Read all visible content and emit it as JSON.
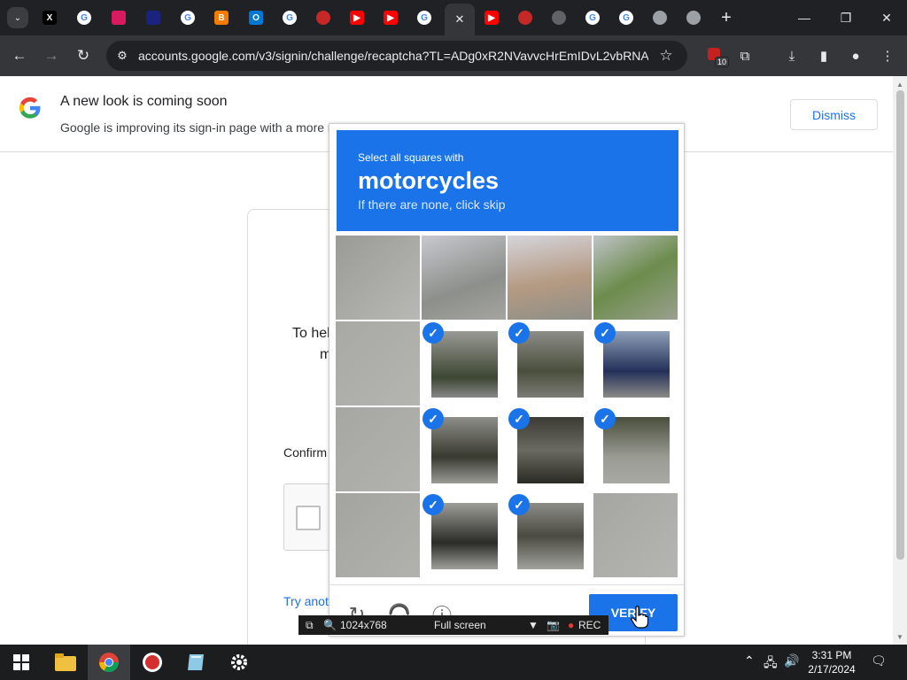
{
  "browser": {
    "tabs": [
      {
        "icon": "x-icon",
        "glyph": "X",
        "bg": "#000000"
      },
      {
        "icon": "google-icon",
        "glyph": "G",
        "bg": "#ffffff"
      },
      {
        "icon": "app-icon",
        "glyph": "",
        "bg": "#d81b60"
      },
      {
        "icon": "app-icon",
        "glyph": "",
        "bg": "#1a237e"
      },
      {
        "icon": "google-icon",
        "glyph": "G",
        "bg": "#ffffff"
      },
      {
        "icon": "blogger-icon",
        "glyph": "B",
        "bg": "#f57c00"
      },
      {
        "icon": "outlook-icon",
        "glyph": "O",
        "bg": "#0078d4"
      },
      {
        "icon": "google-icon",
        "glyph": "G",
        "bg": "#ffffff"
      },
      {
        "icon": "record-icon",
        "glyph": "",
        "bg": "#c62828"
      },
      {
        "icon": "youtube-icon",
        "glyph": "▶",
        "bg": "#ff0000"
      },
      {
        "icon": "youtube-icon",
        "glyph": "▶",
        "bg": "#ff0000"
      },
      {
        "icon": "google-icon",
        "glyph": "G",
        "bg": "#ffffff"
      },
      {
        "icon": "close-icon",
        "glyph": "✕",
        "bg": "active"
      },
      {
        "icon": "youtube-icon",
        "glyph": "▶",
        "bg": "#ff0000"
      },
      {
        "icon": "record-icon",
        "glyph": "",
        "bg": "#c62828"
      },
      {
        "icon": "globe-icon",
        "glyph": "",
        "bg": "#5f6368"
      },
      {
        "icon": "google-icon",
        "glyph": "G",
        "bg": "#ffffff"
      },
      {
        "icon": "google-icon",
        "glyph": "G",
        "bg": "#ffffff"
      },
      {
        "icon": "chrome-icon",
        "glyph": "",
        "bg": "#9aa0a6"
      },
      {
        "icon": "chrome-icon",
        "glyph": "",
        "bg": "#9aa0a6"
      },
      {
        "icon": "chrome-icon",
        "glyph": "",
        "bg": "#9aa0a6"
      }
    ],
    "url": "accounts.google.com/v3/signin/challenge/recaptcha?TL=ADg0xR2NVavvcHrEmIDvL2vbRNA...",
    "extension_badge": "10"
  },
  "banner": {
    "title": "A new look is coming soon",
    "text": "Google is improving its sign-in page with a more m",
    "dismiss_label": "Dismiss"
  },
  "signin": {
    "line1": "To hel",
    "line2": "m",
    "confirm_label": "Confirm",
    "try_link": "Try anot"
  },
  "captcha": {
    "select_text": "Select all squares with",
    "object": "motorcycles",
    "skip_text": "If there are none, click skip",
    "verify_label": "VERIFY",
    "selected": [
      false,
      false,
      false,
      false,
      false,
      true,
      true,
      true,
      false,
      true,
      true,
      true,
      false,
      true,
      true,
      false
    ]
  },
  "recorder": {
    "resolution": "1024x768",
    "mode": "Full screen",
    "rec_label": "REC"
  },
  "taskbar": {
    "time": "3:31 PM",
    "date": "2/17/2024"
  },
  "colors": {
    "accent": "#1a73e8",
    "browser_frame": "#202124"
  }
}
